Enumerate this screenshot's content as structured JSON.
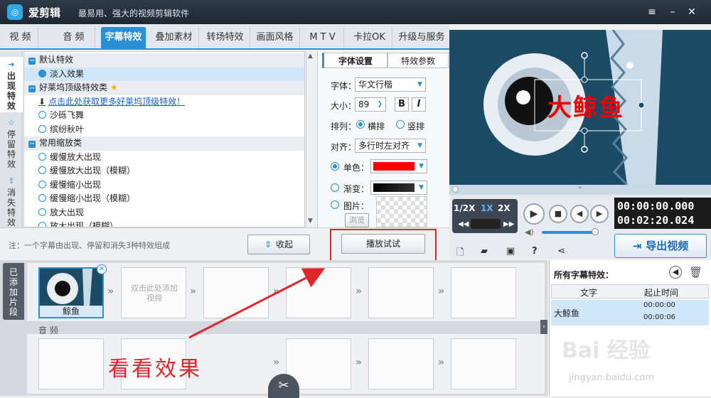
{
  "window": {
    "app_name": "爱剪辑",
    "slogan": "最易用、强大的视频剪辑软件",
    "logo_glyph": "◎"
  },
  "tabs": [
    "视 频",
    "音 频",
    "字幕特效",
    "叠加素材",
    "转场特效",
    "画面风格",
    "M T V",
    "卡拉OK",
    "升级与服务"
  ],
  "vtabs": [
    "出现特效",
    "停留特效",
    "消失特效"
  ],
  "tree": {
    "cat1": "默认特效",
    "item_fade": "淡入效果",
    "cat2": "好莱坞顶级特效类",
    "link": "点击此处获取更多好莱坞顶级特效！",
    "item_sand": "沙砾飞舞",
    "item_leaves": "缤纷秋叶",
    "cat3": "常用缩放类",
    "zoom_items": [
      "缓慢放大出现",
      "缓慢放大出现（模糊）",
      "缓慢缩小出现",
      "缓慢缩小出现（模糊）",
      "放大出现",
      "放大出现（模糊）"
    ]
  },
  "props": {
    "tab_font": "字体设置",
    "tab_effect": "特效参数",
    "font_label": "字体：",
    "font_value": "华文行楷",
    "size_label": "大小：",
    "size_value": "89",
    "bold": "B",
    "italic": "I",
    "layout_label": "排列：",
    "horizontal": "横排",
    "vertical": "竖排",
    "align_label": "对齐：",
    "align_value": "多行时左对齐",
    "solid_label": "单色：",
    "gradient_label": "渐变：",
    "image_label": "图片：",
    "browse": "浏览",
    "solid_color": "#ff0000"
  },
  "bottom": {
    "hint": "注：一个字幕由出现、停留和消失3种特效组成",
    "collapse": "收起",
    "play_test": "播放试试"
  },
  "preview": {
    "caption": "大鲸鱼"
  },
  "controls": {
    "speed_half": "1/2X",
    "speed_1": "1X",
    "speed_2": "2X",
    "time_current": "00:00:00.000",
    "time_total": "00:02:20.024",
    "export": "导出视频"
  },
  "timeline": {
    "side_tab": "已添加片段",
    "clip_label": "鲸鱼",
    "add_hint": "双击此处添加视频",
    "audio_label": "音 频"
  },
  "effects_panel": {
    "title": "所有字幕特效：",
    "col_text": "文字",
    "col_time": "起止时间",
    "row_text": "大鲸鱼",
    "row_start": "00:00:00",
    "row_end": "00:00:06"
  },
  "annotation": {
    "text": "看看效果"
  },
  "watermark": {
    "brand": "Bai 经验",
    "url": "jingyan.baidu.com"
  }
}
